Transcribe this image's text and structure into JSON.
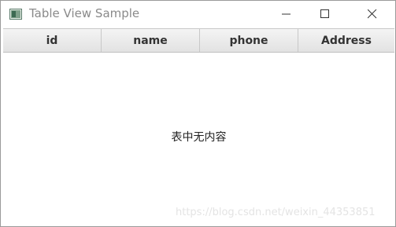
{
  "window": {
    "title": "Table View Sample",
    "icon": "java-app-icon",
    "controls": [
      "minimize-icon",
      "maximize-icon",
      "close-icon"
    ]
  },
  "table": {
    "columns": [
      "id",
      "name",
      "phone",
      "Address"
    ],
    "rows": [],
    "placeholder": "表中无内容"
  },
  "watermark": "https://blog.csdn.net/weixin_44353851",
  "colors": {
    "header_top": "#f4f4f4",
    "header_bottom": "#e2e2e2",
    "title_text": "#8a8a8a"
  }
}
